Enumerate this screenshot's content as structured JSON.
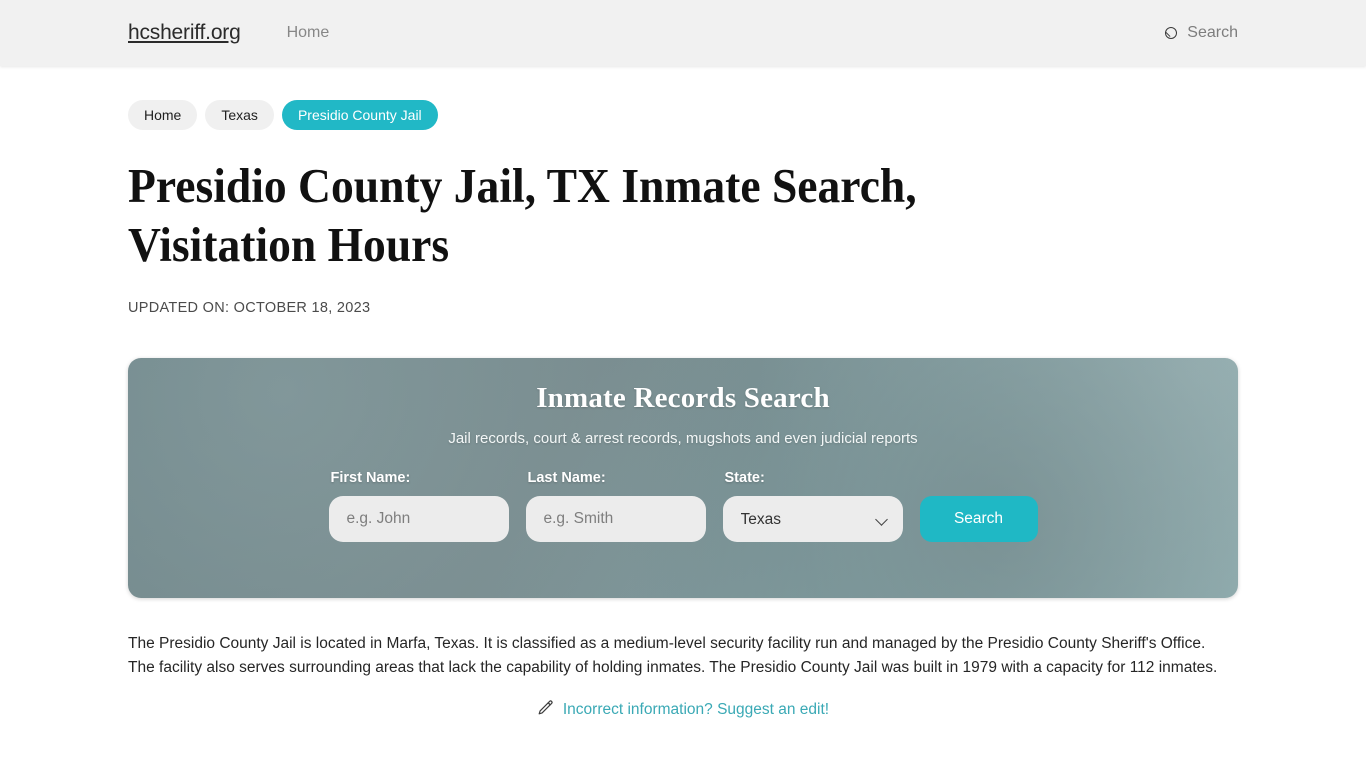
{
  "header": {
    "brand": "hcsheriff.org",
    "nav": [
      {
        "label": "Home"
      }
    ],
    "search": {
      "icon": "search-icon",
      "label": "Search"
    }
  },
  "breadcrumb": [
    {
      "label": "Home",
      "current": false
    },
    {
      "label": "Texas",
      "current": false
    },
    {
      "label": "Presidio County Jail",
      "current": true
    }
  ],
  "main": {
    "title": "Presidio County Jail, TX Inmate Search, Visitation Hours",
    "updated": "UPDATED ON: OCTOBER 18, 2023",
    "paragraph": "The Presidio County Jail is located in Marfa, Texas. It is classified as a medium-level security facility run and managed by the Presidio County Sheriff's Office. The facility also serves surrounding areas that lack the capability of holding inmates. The Presidio County Jail was built in 1979 with a capacity for 112 inmates.",
    "suggest": {
      "icon": "pencil-icon",
      "label": "Incorrect information? Suggest an edit!"
    }
  },
  "search_panel": {
    "title": "Inmate Records Search",
    "subtitle": "Jail records, court & arrest records, mugshots and even judicial reports",
    "first_name": {
      "label": "First Name:",
      "placeholder": "e.g. John",
      "value": ""
    },
    "last_name": {
      "label": "Last Name:",
      "placeholder": "e.g. Smith",
      "value": ""
    },
    "state": {
      "label": "State:",
      "selected": "Texas",
      "options": [
        "Texas"
      ]
    },
    "submit_label": "Search"
  },
  "colors": {
    "accent_teal": "#1fb8c5",
    "crumb_active": "#21b8c6",
    "link_teal": "#3aa9b5",
    "header_bg": "#f1f1f1",
    "panel_bg": "#76898c"
  }
}
